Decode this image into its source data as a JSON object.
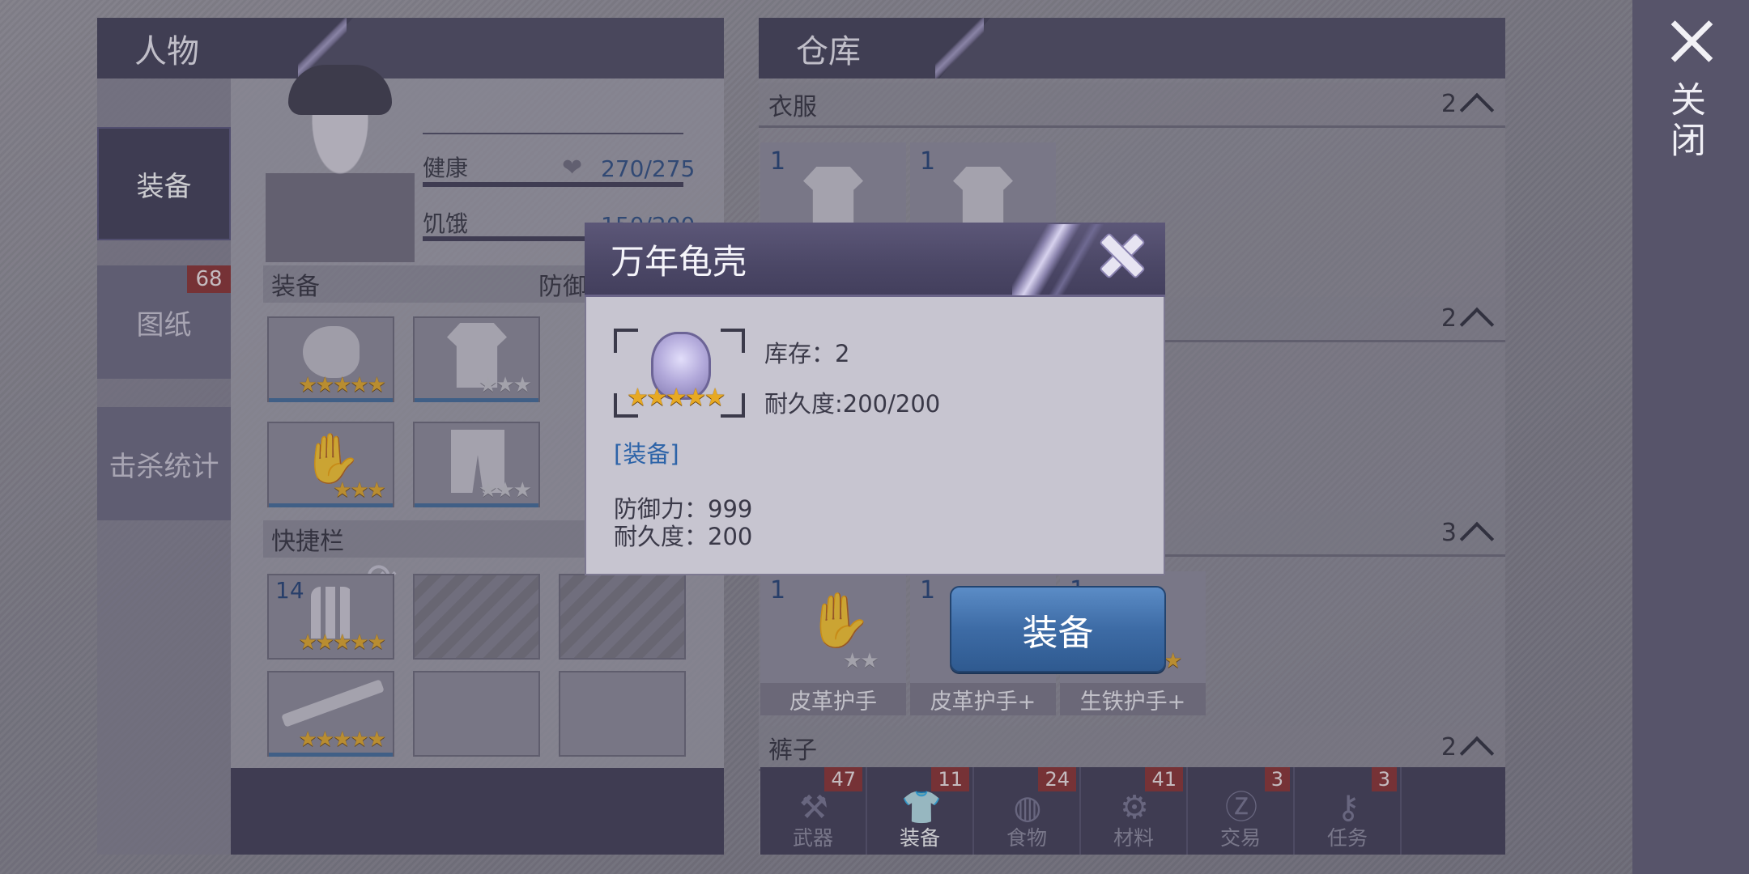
{
  "left_panel": {
    "title": "人物",
    "nav": [
      {
        "label": "装备",
        "active": true
      },
      {
        "label": "图纸",
        "badge": "68"
      },
      {
        "label": "击杀统计"
      }
    ],
    "stats": {
      "health_label": "健康",
      "health_value": "270/275",
      "hunger_label": "饥饿",
      "hunger_value": "150/200"
    },
    "equip_section": {
      "label": "装备",
      "defense_label": "防御"
    },
    "equip_slots": [
      {
        "item": "helmet",
        "stars_gold": 5,
        "stars_grey": 0
      },
      {
        "item": "hoodie",
        "stars_gold": 0,
        "stars_grey": 3
      },
      {
        "item": "gloves",
        "stars_gold": 3,
        "stars_grey": 0
      },
      {
        "item": "shorts",
        "stars_gold": 0,
        "stars_grey": 3
      }
    ],
    "quickbar_section": {
      "label": "快捷栏"
    },
    "quickbar_slots": [
      {
        "item": "bullets",
        "count": "14",
        "stars_gold": 5
      },
      {
        "item": "rifle",
        "stars_gold": 5
      }
    ]
  },
  "right_panel": {
    "title": "仓库",
    "categories": [
      {
        "label": "衣服",
        "count": "2"
      },
      {
        "label": "",
        "count": "2"
      },
      {
        "label": "",
        "count": "3"
      },
      {
        "label": "裤子",
        "count": "2"
      }
    ],
    "clothes_items": [
      {
        "count": "1",
        "name": ""
      },
      {
        "count": "1",
        "name": ""
      }
    ],
    "glove_items": [
      {
        "count": "1",
        "name": "皮革护手",
        "stars_grey": 2
      },
      {
        "count": "1",
        "name": "皮革护手+"
      },
      {
        "count": "1",
        "name": "生铁护手+",
        "stars_gold": 1
      }
    ],
    "bottom_tabs": [
      {
        "label": "武器",
        "badge": "47",
        "icon": "axe-icon"
      },
      {
        "label": "装备",
        "badge": "11",
        "icon": "shirt-icon",
        "active": true
      },
      {
        "label": "食物",
        "badge": "24",
        "icon": "food-icon"
      },
      {
        "label": "材料",
        "badge": "41",
        "icon": "material-icon"
      },
      {
        "label": "交易",
        "badge": "3",
        "icon": "coin-icon"
      },
      {
        "label": "任务",
        "badge": "3",
        "icon": "key-icon"
      }
    ]
  },
  "close_strip": {
    "label": "关闭"
  },
  "modal": {
    "title": "万年龟壳",
    "stock_text": "库存：2",
    "durability_text": "耐久度:200/200",
    "link_text": "[装备]",
    "defense_text": "防御力：999",
    "durability2_text": "耐久度：200",
    "item_stars": 5,
    "equip_button": "装备"
  },
  "colors": {
    "accent_blue": "#3d6ba5",
    "badge_red": "#8a2c2c",
    "header_purple": "#4b4860",
    "star_gold": "#e7a923"
  }
}
